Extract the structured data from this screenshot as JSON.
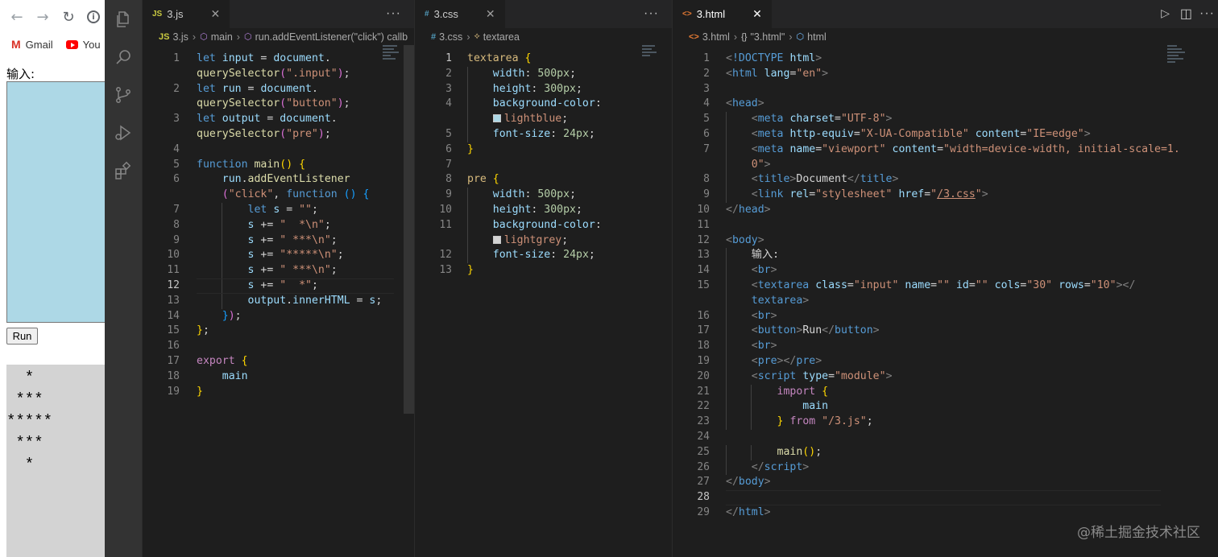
{
  "browser": {
    "nav": {
      "back": "←",
      "forward": "→",
      "reload": "↻",
      "info": "i"
    },
    "bookmarks": [
      {
        "label": "Gmail",
        "icon": "gmail-icon"
      },
      {
        "label": "You",
        "icon": "youtube-icon"
      }
    ],
    "input_label": "输入:",
    "run_button": "Run",
    "pre_output": "  *\n ***\n*****\n ***\n  *",
    "colors": {
      "textarea_bg": "#add8e6",
      "pre_bg": "#d3d3d3"
    }
  },
  "activity_bar": [
    "files-icon",
    "search-icon",
    "source-control-icon",
    "run-debug-icon",
    "extensions-icon"
  ],
  "editors": {
    "js": {
      "tab": {
        "icon": "JS",
        "label": "3.js",
        "close": "✕"
      },
      "more": "···",
      "breadcrumb": {
        "file": "3.js",
        "item1": "main",
        "item2": "run.addEventListener(\"click\") callb"
      },
      "lines": [
        {
          "n": "1",
          "h": "<span class=\"k\">let</span> <span class=\"v\">input</span> = <span class=\"v\">document</span>."
        },
        {
          "n": "",
          "h": "<span class=\"f\">querySelector</span><span class=\"pk\">(</span><span class=\"s\">\".input\"</span><span class=\"pk\">)</span>;"
        },
        {
          "n": "2",
          "h": "<span class=\"k\">let</span> <span class=\"v\">run</span> = <span class=\"v\">document</span>."
        },
        {
          "n": "",
          "h": "<span class=\"f\">querySelector</span><span class=\"pk\">(</span><span class=\"s\">\"button\"</span><span class=\"pk\">)</span>;"
        },
        {
          "n": "3",
          "h": "<span class=\"k\">let</span> <span class=\"v\">output</span> = <span class=\"v\">document</span>."
        },
        {
          "n": "",
          "h": "<span class=\"f\">querySelector</span><span class=\"pk\">(</span><span class=\"s\">\"pre\"</span><span class=\"pk\">)</span>;"
        },
        {
          "n": "4",
          "h": ""
        },
        {
          "n": "5",
          "h": "<span class=\"k\">function</span> <span class=\"f\">main</span><span class=\"y\">()</span> <span class=\"y\">{</span>"
        },
        {
          "n": "6",
          "h": "    <span class=\"v\">run</span>.<span class=\"f\">addEventListener</span>"
        },
        {
          "n": "",
          "h": "    <span class=\"pk\">(</span><span class=\"s\">\"click\"</span>, <span class=\"k\">function</span> <span class=\"bl\">()</span> <span class=\"bl\">{</span>"
        },
        {
          "n": "7",
          "h": "        <span class=\"k\">let</span> <span class=\"v\">s</span> = <span class=\"s\">\"\"</span>;"
        },
        {
          "n": "8",
          "h": "        <span class=\"v\">s</span> += <span class=\"s\">\"  *\\n\"</span>;"
        },
        {
          "n": "9",
          "h": "        <span class=\"v\">s</span> += <span class=\"s\">\" ***\\n\"</span>;"
        },
        {
          "n": "10",
          "h": "        <span class=\"v\">s</span> += <span class=\"s\">\"*****\\n\"</span>;"
        },
        {
          "n": "11",
          "h": "        <span class=\"v\">s</span> += <span class=\"s\">\" ***\\n\"</span>;"
        },
        {
          "n": "12",
          "h": "        <span class=\"v\">s</span> += <span class=\"s\">\"  *\"</span>;"
        },
        {
          "n": "13",
          "h": "        <span class=\"v\">output</span>.<span class=\"v\">innerHTML</span> = <span class=\"v\">s</span>;"
        },
        {
          "n": "14",
          "h": "    <span class=\"bl\">}</span><span class=\"pk\">)</span>;"
        },
        {
          "n": "15",
          "h": "<span class=\"y\">}</span>;"
        },
        {
          "n": "16",
          "h": ""
        },
        {
          "n": "17",
          "h": "<span class=\"cf\">export</span> <span class=\"y\">{</span>"
        },
        {
          "n": "18",
          "h": "    <span class=\"v\">main</span>"
        },
        {
          "n": "19",
          "h": "<span class=\"y\">}</span>"
        }
      ]
    },
    "css": {
      "tab": {
        "icon": "#",
        "label": "3.css",
        "close": "✕"
      },
      "more": "···",
      "breadcrumb": {
        "file": "3.css",
        "item1": "textarea"
      },
      "lines": [
        {
          "n": "1",
          "h": "<span class=\"sel\">textarea</span> <span class=\"y\">{</span>"
        },
        {
          "n": "2",
          "h": "    <span class=\"prop\">width</span>: <span class=\"num\">500px</span>;"
        },
        {
          "n": "3",
          "h": "    <span class=\"prop\">height</span>: <span class=\"num\">300px</span>;"
        },
        {
          "n": "4",
          "h": "    <span class=\"prop\">background-color</span>:"
        },
        {
          "n": "",
          "h": "    <span class=\"sw\" style=\"background:#add8e6\"></span><span class=\"s\">lightblue</span>;"
        },
        {
          "n": "5",
          "h": "    <span class=\"prop\">font-size</span>: <span class=\"num\">24px</span>;"
        },
        {
          "n": "6",
          "h": "<span class=\"y\">}</span>"
        },
        {
          "n": "7",
          "h": ""
        },
        {
          "n": "8",
          "h": "<span class=\"sel\">pre</span> <span class=\"y\">{</span>"
        },
        {
          "n": "9",
          "h": "    <span class=\"prop\">width</span>: <span class=\"num\">500px</span>;"
        },
        {
          "n": "10",
          "h": "    <span class=\"prop\">height</span>: <span class=\"num\">300px</span>;"
        },
        {
          "n": "11",
          "h": "    <span class=\"prop\">background-color</span>:"
        },
        {
          "n": "",
          "h": "    <span class=\"sw\" style=\"background:#d3d3d3\"></span><span class=\"s\">lightgrey</span>;"
        },
        {
          "n": "12",
          "h": "    <span class=\"prop\">font-size</span>: <span class=\"num\">24px</span>;"
        },
        {
          "n": "13",
          "h": "<span class=\"y\">}</span>"
        }
      ]
    },
    "html": {
      "tab": {
        "icon": "<>",
        "label": "3.html",
        "close": "✕"
      },
      "actions": {
        "run": "▷",
        "split": "◫",
        "more": "···"
      },
      "breadcrumb": {
        "file": "3.html",
        "item1": "\"3.html\"",
        "item2": "html"
      },
      "lines": [
        {
          "n": "1",
          "h": "<span class=\"pu\">&lt;</span><span class=\"tg\">!DOCTYPE</span> <span class=\"at\">html</span><span class=\"pu\">&gt;</span>"
        },
        {
          "n": "2",
          "h": "<span class=\"pu\">&lt;</span><span class=\"tg\">html</span> <span class=\"at\">lang</span>=<span class=\"s\">\"en\"</span><span class=\"pu\">&gt;</span>"
        },
        {
          "n": "3",
          "h": ""
        },
        {
          "n": "4",
          "h": "<span class=\"pu\">&lt;</span><span class=\"tg\">head</span><span class=\"pu\">&gt;</span>"
        },
        {
          "n": "5",
          "h": "    <span class=\"pu\">&lt;</span><span class=\"tg\">meta</span> <span class=\"at\">charset</span>=<span class=\"s\">\"UTF-8\"</span><span class=\"pu\">&gt;</span>"
        },
        {
          "n": "6",
          "h": "    <span class=\"pu\">&lt;</span><span class=\"tg\">meta</span> <span class=\"at\">http-equiv</span>=<span class=\"s\">\"X-UA-Compatible\"</span> <span class=\"at\">content</span>=<span class=\"s\">\"IE=edge\"</span><span class=\"pu\">&gt;</span>"
        },
        {
          "n": "7",
          "h": "    <span class=\"pu\">&lt;</span><span class=\"tg\">meta</span> <span class=\"at\">name</span>=<span class=\"s\">\"viewport\"</span> <span class=\"at\">content</span>=<span class=\"s\">\"width=device-width, initial-scale=1.</span>"
        },
        {
          "n": "",
          "h": "    <span class=\"s\">0\"</span><span class=\"pu\">&gt;</span>"
        },
        {
          "n": "8",
          "h": "    <span class=\"pu\">&lt;</span><span class=\"tg\">title</span><span class=\"pu\">&gt;</span><span class=\"t\">Document</span><span class=\"pu\">&lt;/</span><span class=\"tg\">title</span><span class=\"pu\">&gt;</span>"
        },
        {
          "n": "9",
          "h": "    <span class=\"pu\">&lt;</span><span class=\"tg\">link</span> <span class=\"at\">rel</span>=<span class=\"s\">\"stylesheet\"</span> <span class=\"at\">href</span>=<span class=\"s\">\"<u>/3.css</u>\"</span><span class=\"pu\">&gt;</span>"
        },
        {
          "n": "10",
          "h": "<span class=\"pu\">&lt;/</span><span class=\"tg\">head</span><span class=\"pu\">&gt;</span>"
        },
        {
          "n": "11",
          "h": ""
        },
        {
          "n": "12",
          "h": "<span class=\"pu\">&lt;</span><span class=\"tg\">body</span><span class=\"pu\">&gt;</span>"
        },
        {
          "n": "13",
          "h": "    <span class=\"t\">输入:</span>"
        },
        {
          "n": "14",
          "h": "    <span class=\"pu\">&lt;</span><span class=\"tg\">br</span><span class=\"pu\">&gt;</span>"
        },
        {
          "n": "15",
          "h": "    <span class=\"pu\">&lt;</span><span class=\"tg\">textarea</span> <span class=\"at\">class</span>=<span class=\"s\">\"input\"</span> <span class=\"at\">name</span>=<span class=\"s\">\"\"</span> <span class=\"at\">id</span>=<span class=\"s\">\"\"</span> <span class=\"at\">cols</span>=<span class=\"s\">\"30\"</span> <span class=\"at\">rows</span>=<span class=\"s\">\"10\"</span><span class=\"pu\">&gt;&lt;/</span>"
        },
        {
          "n": "",
          "h": "    <span class=\"tg\">textarea</span><span class=\"pu\">&gt;</span>"
        },
        {
          "n": "16",
          "h": "    <span class=\"pu\">&lt;</span><span class=\"tg\">br</span><span class=\"pu\">&gt;</span>"
        },
        {
          "n": "17",
          "h": "    <span class=\"pu\">&lt;</span><span class=\"tg\">button</span><span class=\"pu\">&gt;</span><span class=\"t\">Run</span><span class=\"pu\">&lt;/</span><span class=\"tg\">button</span><span class=\"pu\">&gt;</span>"
        },
        {
          "n": "18",
          "h": "    <span class=\"pu\">&lt;</span><span class=\"tg\">br</span><span class=\"pu\">&gt;</span>"
        },
        {
          "n": "19",
          "h": "    <span class=\"pu\">&lt;</span><span class=\"tg\">pre</span><span class=\"pu\">&gt;&lt;/</span><span class=\"tg\">pre</span><span class=\"pu\">&gt;</span>"
        },
        {
          "n": "20",
          "h": "    <span class=\"pu\">&lt;</span><span class=\"tg\">script</span> <span class=\"at\">type</span>=<span class=\"s\">\"module\"</span><span class=\"pu\">&gt;</span>"
        },
        {
          "n": "21",
          "h": "        <span class=\"cf\">import</span> <span class=\"y\">{</span>"
        },
        {
          "n": "22",
          "h": "            <span class=\"v\">main</span>"
        },
        {
          "n": "23",
          "h": "        <span class=\"y\">}</span> <span class=\"cf\">from</span> <span class=\"s\">\"/3.js\"</span>;"
        },
        {
          "n": "24",
          "h": ""
        },
        {
          "n": "25",
          "h": "        <span class=\"f\">main</span><span class=\"y\">()</span>;"
        },
        {
          "n": "26",
          "h": "    <span class=\"pu\">&lt;/</span><span class=\"tg\">script</span><span class=\"pu\">&gt;</span>"
        },
        {
          "n": "27",
          "h": "<span class=\"pu\">&lt;/</span><span class=\"tg\">body</span><span class=\"pu\">&gt;</span>"
        },
        {
          "n": "28",
          "h": ""
        },
        {
          "n": "29",
          "h": "<span class=\"pu\">&lt;/</span><span class=\"tg\">html</span><span class=\"pu\">&gt;</span>"
        }
      ]
    }
  },
  "watermark": "@稀土掘金技术社区",
  "colors": {
    "editor_bg": "#1e1e1e",
    "activity_bg": "#333333",
    "tabbar_bg": "#252526"
  }
}
